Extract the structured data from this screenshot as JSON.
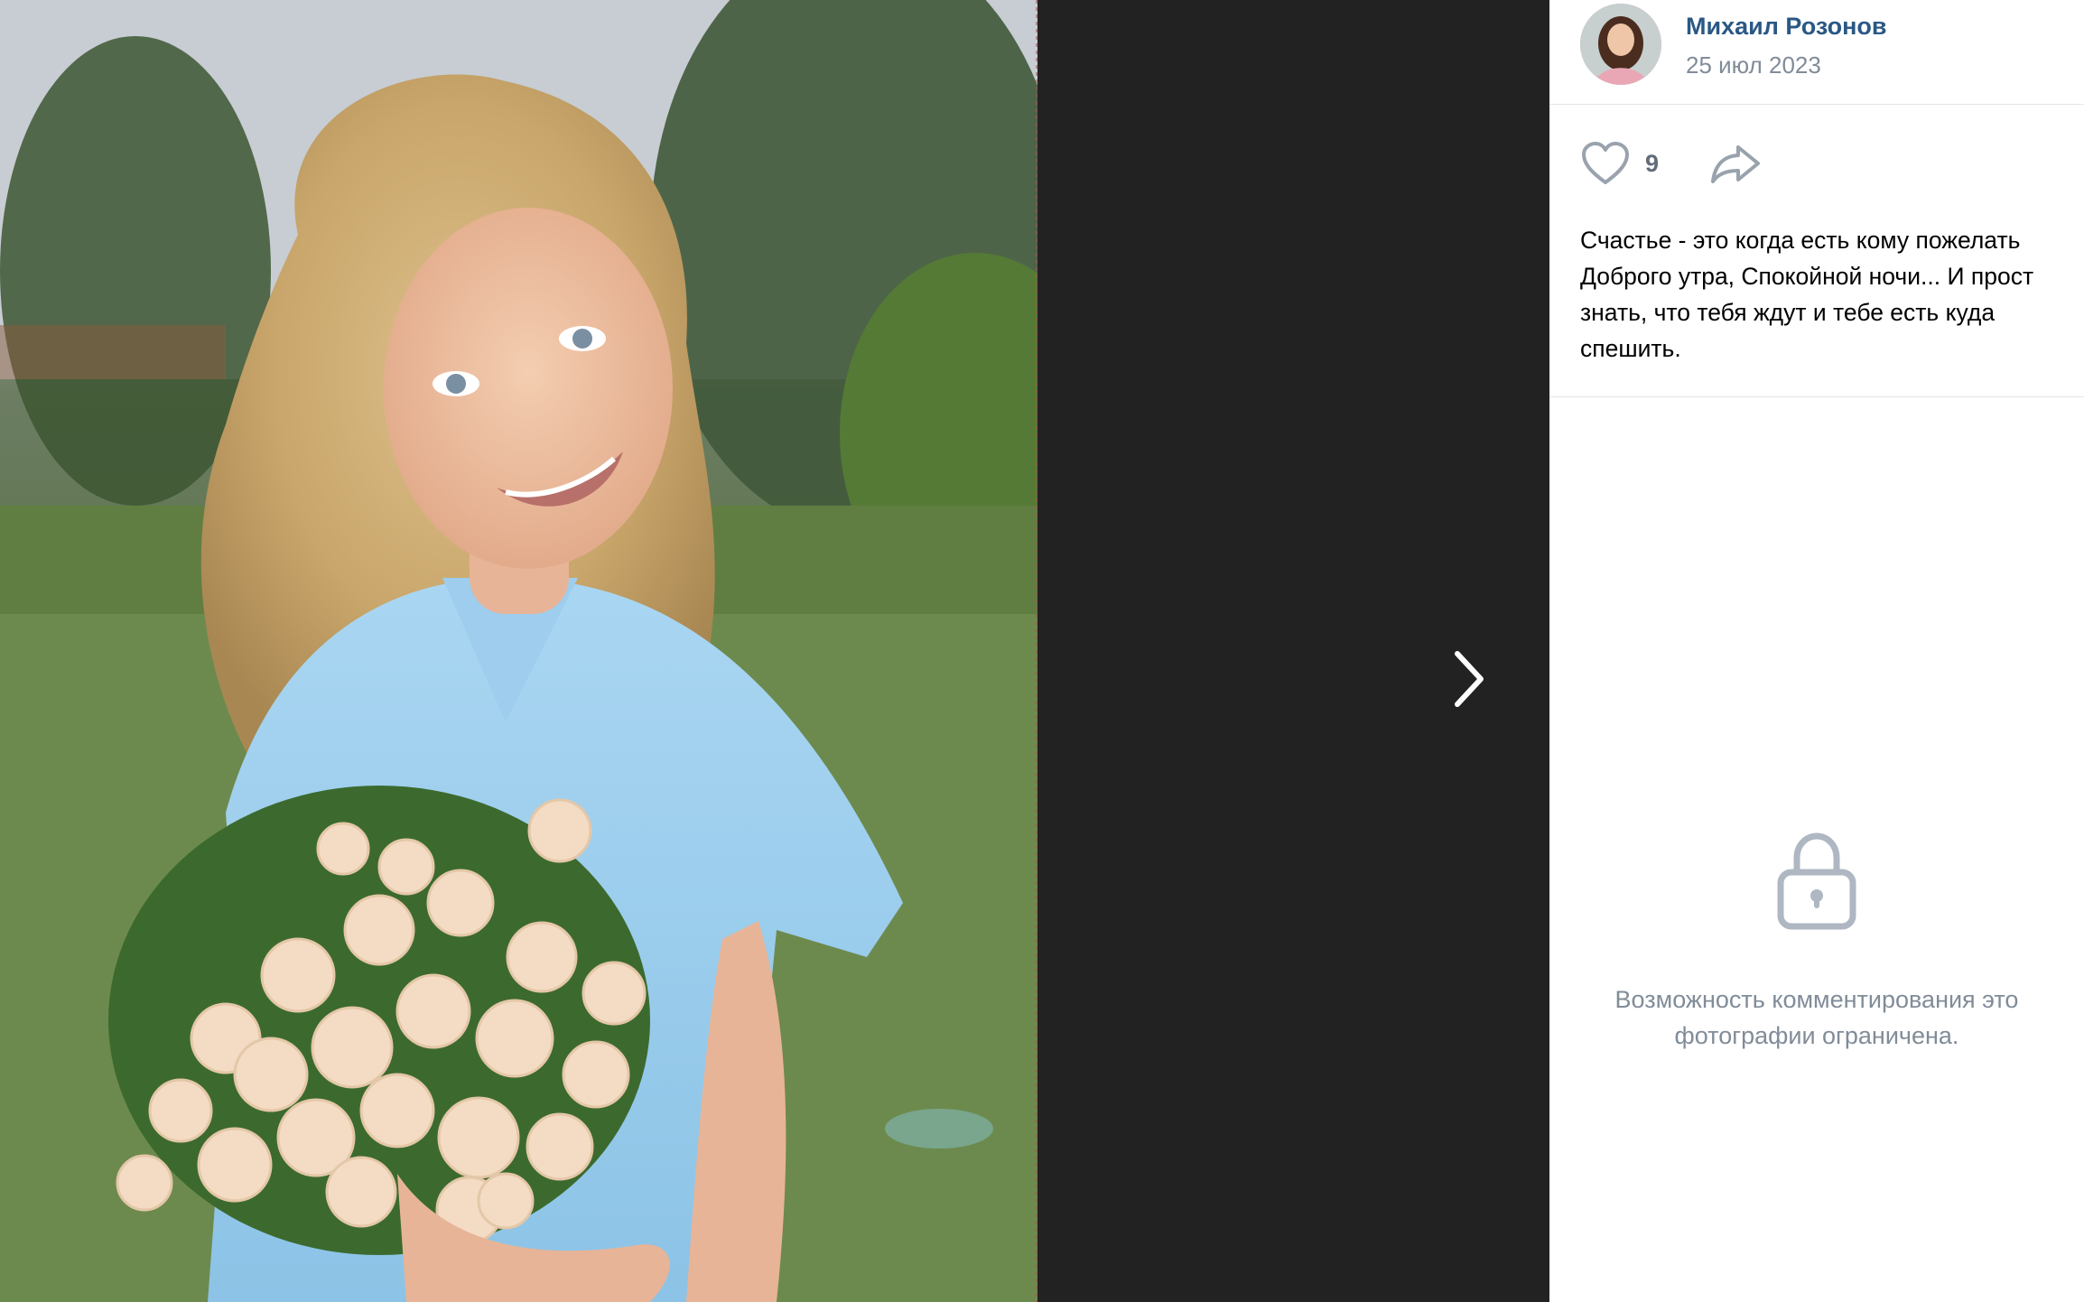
{
  "author": {
    "name": "Михаил Розонов",
    "date": "25 июл 2023",
    "avatar_icon": "avatar-photo"
  },
  "actions": {
    "like_icon": "heart-icon",
    "like_count": "9",
    "share_icon": "share-arrow-icon"
  },
  "caption": {
    "lines": [
      "Счастье - это когда есть кому пожелать",
      "Доброго утра, Спокойной ночи... И прост",
      "знать, что тебя ждут и тебе есть куда",
      "спешить."
    ]
  },
  "comments": {
    "lock_icon": "lock-icon",
    "restricted_lines": [
      "Возможность комментирования это",
      "фотографии ограничена."
    ]
  },
  "navigation": {
    "next_icon": "chevron-right-icon"
  },
  "colors": {
    "link": "#2a5885",
    "muted": "#818c99",
    "stage": "#222222"
  }
}
